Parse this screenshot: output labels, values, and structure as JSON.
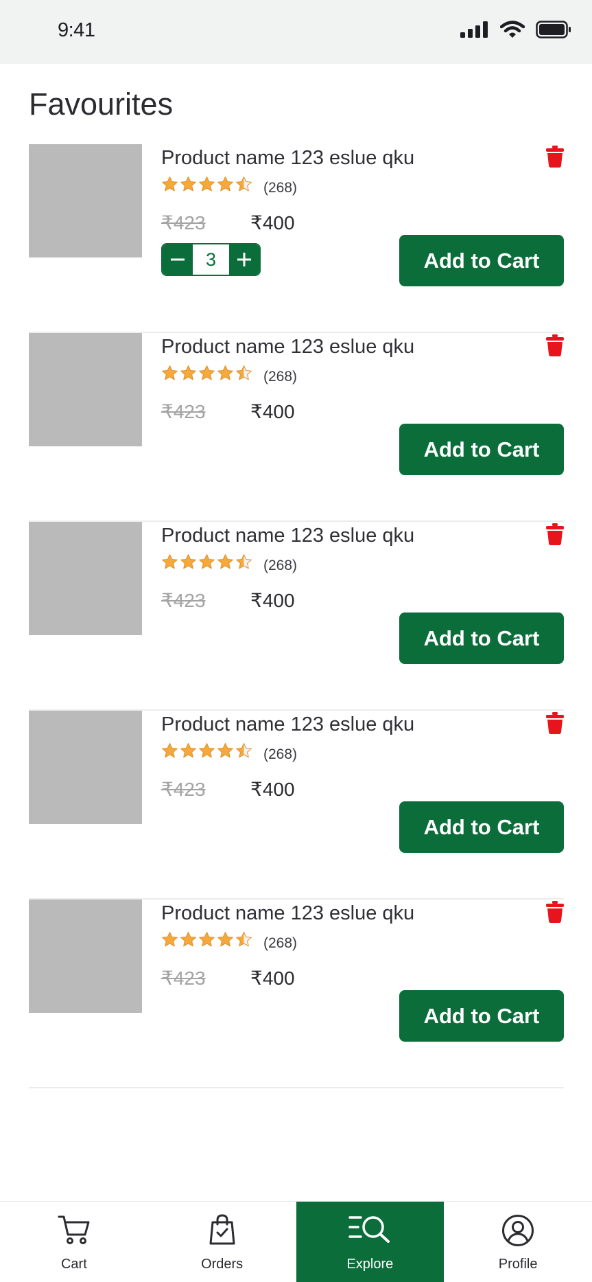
{
  "status_bar": {
    "time": "9:41"
  },
  "page": {
    "title": "Favourites"
  },
  "items": [
    {
      "name": "Product name 123 eslue qku",
      "rating": 4.5,
      "reviews": "(268)",
      "old_price": "₹423",
      "price": "₹400",
      "quantity": "3",
      "cart_label": "Add to Cart"
    },
    {
      "name": "Product name 123 eslue qku",
      "rating": 4.5,
      "reviews": "(268)",
      "old_price": "₹423",
      "price": "₹400",
      "cart_label": "Add to Cart"
    },
    {
      "name": "Product name 123 eslue qku",
      "rating": 4.5,
      "reviews": "(268)",
      "old_price": "₹423",
      "price": "₹400",
      "cart_label": "Add to Cart"
    },
    {
      "name": "Product name 123 eslue qku",
      "rating": 4.5,
      "reviews": "(268)",
      "old_price": "₹423",
      "price": "₹400",
      "cart_label": "Add to Cart"
    },
    {
      "name": "Product name 123 eslue qku",
      "rating": 4.5,
      "reviews": "(268)",
      "old_price": "₹423",
      "price": "₹400",
      "cart_label": "Add to Cart"
    }
  ],
  "tabbar": {
    "tabs": [
      {
        "label": "Cart",
        "icon": "cart-icon"
      },
      {
        "label": "Orders",
        "icon": "shopping-bag-icon"
      },
      {
        "label": "Explore",
        "icon": "explore-search-icon",
        "active": true
      },
      {
        "label": "Profile",
        "icon": "profile-icon"
      }
    ]
  },
  "colors": {
    "brand": "#0b6e3a",
    "delete": "#e8141b",
    "star": "#f5a93b",
    "placeholder": "#bababa"
  }
}
